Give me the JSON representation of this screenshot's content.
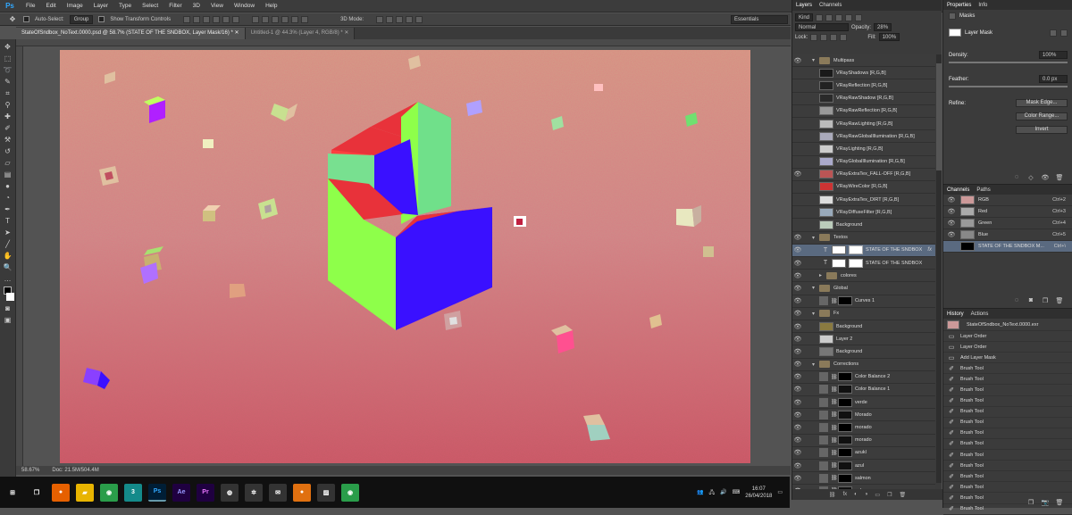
{
  "menubar": {
    "logo": "Ps",
    "items": [
      "File",
      "Edit",
      "Image",
      "Layer",
      "Type",
      "Select",
      "Filter",
      "3D",
      "View",
      "Window",
      "Help"
    ],
    "controls": [
      "–",
      "□",
      "✕"
    ]
  },
  "options": {
    "auto_select_label": "Auto-Select:",
    "auto_select_value": "Group",
    "transform_label": "Show Transform Controls",
    "mode_3d_label": "3D Mode:",
    "workspace": "Essentials"
  },
  "tabs": [
    {
      "label": "StateOfSndbox_NoText.0000.psd @ 58.7% (STATE OF THE SNDBOX, Layer Mask/16) *  ✕",
      "active": true
    },
    {
      "label": "Untitled-1 @ 44.3% (Layer 4, RGB/8) *  ✕",
      "active": false
    }
  ],
  "status": {
    "zoom": "58.67%",
    "doc": "Doc: 21.5M/504.4M"
  },
  "layers": {
    "tabs": [
      "Layers",
      "Channels"
    ],
    "kind_label": "Kind",
    "blend_mode": "Normal",
    "opacity_label": "Opacity:",
    "opacity_value": "28%",
    "lock_label": "Lock:",
    "fill_label": "Fill:",
    "fill_value": "100%",
    "items": [
      {
        "name": "Multipass",
        "type": "group",
        "eye": true,
        "depth": 0
      },
      {
        "name": "VRayShadows [R,G,B]",
        "type": "layer",
        "eye": false,
        "depth": 1,
        "thumb": "#1a1a1a"
      },
      {
        "name": "VRayReflection [R,G,B]",
        "type": "layer",
        "eye": false,
        "depth": 1,
        "thumb": "#222"
      },
      {
        "name": "VRayRawShadow [R,G,B]",
        "type": "layer",
        "eye": false,
        "depth": 1,
        "thumb": "#2a2a2a"
      },
      {
        "name": "VRayRawReflection [R,G,B]",
        "type": "layer",
        "eye": false,
        "depth": 1,
        "thumb": "#999"
      },
      {
        "name": "VRayRawLighting [R,G,B]",
        "type": "layer",
        "eye": false,
        "depth": 1,
        "thumb": "#bbb"
      },
      {
        "name": "VRayRawGlobalIllumination [R,G,B]",
        "type": "layer",
        "eye": false,
        "depth": 1,
        "thumb": "#aab"
      },
      {
        "name": "VRayLighting [R,G,B]",
        "type": "layer",
        "eye": false,
        "depth": 1,
        "thumb": "#ccc"
      },
      {
        "name": "VRayGlobalIllumination [R,G,B]",
        "type": "layer",
        "eye": false,
        "depth": 1,
        "thumb": "#aac"
      },
      {
        "name": "VRayExtraTex_FALL-OFF [R,G,B]",
        "type": "layer",
        "eye": true,
        "depth": 1,
        "thumb": "#b55"
      },
      {
        "name": "VRayWireColor [R,G,B]",
        "type": "layer",
        "eye": false,
        "depth": 1,
        "thumb": "#c33"
      },
      {
        "name": "VRayExtraTex_DIRT [R,G,B]",
        "type": "layer",
        "eye": false,
        "depth": 1,
        "thumb": "#ddd"
      },
      {
        "name": "VRayDiffuseFilter [R,G,B]",
        "type": "layer",
        "eye": false,
        "depth": 1,
        "thumb": "#9ab"
      },
      {
        "name": "Background",
        "type": "layer",
        "eye": false,
        "depth": 1,
        "thumb": "#bcb"
      },
      {
        "name": "Textos",
        "type": "group",
        "eye": true,
        "depth": 0
      },
      {
        "name": "STATE OF THE SNDBOX",
        "type": "text",
        "eye": true,
        "depth": 1,
        "selected": true,
        "fx": "fx"
      },
      {
        "name": "STATE OF THE SNDBOX",
        "type": "text",
        "eye": true,
        "depth": 1
      },
      {
        "name": "colores",
        "type": "group",
        "eye": true,
        "depth": 1,
        "collapsed": true
      },
      {
        "name": "Global",
        "type": "group",
        "eye": true,
        "depth": 0
      },
      {
        "name": "Curves 1",
        "type": "adjust",
        "eye": true,
        "depth": 1
      },
      {
        "name": "Fx",
        "type": "group",
        "eye": true,
        "depth": 0
      },
      {
        "name": "Background",
        "type": "layer",
        "eye": true,
        "depth": 1,
        "thumb": "#8a7a40"
      },
      {
        "name": "Layer 2",
        "type": "layer",
        "eye": true,
        "depth": 1,
        "thumb": "#ccc"
      },
      {
        "name": "Background",
        "type": "layer",
        "eye": true,
        "depth": 1,
        "thumb": "#777"
      },
      {
        "name": "Corrections",
        "type": "group",
        "eye": true,
        "depth": 0
      },
      {
        "name": "Color Balance 2",
        "type": "adjust",
        "eye": true,
        "depth": 1
      },
      {
        "name": "Color Balance 1",
        "type": "adjust",
        "eye": true,
        "depth": 1
      },
      {
        "name": "verde",
        "type": "adjust",
        "eye": true,
        "depth": 1
      },
      {
        "name": "Morado",
        "type": "adjust",
        "eye": true,
        "depth": 1
      },
      {
        "name": "morado",
        "type": "adjust",
        "eye": true,
        "depth": 1
      },
      {
        "name": "morado",
        "type": "adjust",
        "eye": true,
        "depth": 1
      },
      {
        "name": "azukl",
        "type": "adjust",
        "eye": true,
        "depth": 1
      },
      {
        "name": "azul",
        "type": "adjust",
        "eye": true,
        "depth": 1
      },
      {
        "name": "salmon",
        "type": "adjust",
        "eye": true,
        "depth": 1
      },
      {
        "name": "salmon",
        "type": "adjust",
        "eye": true,
        "depth": 1
      }
    ],
    "footer": [
      "⛓",
      "fx",
      "◐",
      "◑",
      "▭",
      "❐",
      "🗑"
    ]
  },
  "properties": {
    "tabs": [
      "Properties",
      "Info"
    ],
    "title": "Masks",
    "mask_label": "Layer Mask",
    "density_label": "Density:",
    "density_value": "100%",
    "feather_label": "Feather:",
    "feather_value": "0.0 px",
    "refine_label": "Refine:",
    "buttons": [
      "Mask Edge...",
      "Color Range...",
      "Invert"
    ]
  },
  "channels": {
    "tabs": [
      "Channels",
      "Paths"
    ],
    "items": [
      {
        "name": "RGB",
        "key": "Ctrl+2",
        "thumb": "#c99"
      },
      {
        "name": "Red",
        "key": "Ctrl+3",
        "thumb": "#aaa"
      },
      {
        "name": "Green",
        "key": "Ctrl+4",
        "thumb": "#999"
      },
      {
        "name": "Blue",
        "key": "Ctrl+5",
        "thumb": "#888"
      },
      {
        "name": "STATE OF THE SNDBOX M...",
        "key": "Ctrl+\\",
        "thumb": "#000",
        "selected": true
      }
    ]
  },
  "history": {
    "tabs": [
      "History",
      "Actions"
    ],
    "snapshot": "StateOfSndbox_NoText.0000.exr",
    "items": [
      "Layer Order",
      "Layer Order",
      "Add Layer Mask",
      "Brush Tool",
      "Brush Tool",
      "Brush Tool",
      "Brush Tool",
      "Brush Tool",
      "Brush Tool",
      "Brush Tool",
      "Brush Tool",
      "Brush Tool",
      "Brush Tool",
      "Brush Tool",
      "Brush Tool",
      "Brush Tool",
      "Brush Tool"
    ]
  },
  "taskbar": {
    "icons": [
      {
        "name": "start",
        "label": "⊞",
        "color": "#101010"
      },
      {
        "name": "task-view",
        "label": "❐",
        "color": "#101010"
      },
      {
        "name": "firefox",
        "label": "●",
        "color": "#e66000"
      },
      {
        "name": "explorer",
        "label": "▰",
        "color": "#e8b400"
      },
      {
        "name": "chrome",
        "label": "◉",
        "color": "#2a9d4a"
      },
      {
        "name": "3ds-max",
        "label": "3",
        "color": "#148a8a"
      },
      {
        "name": "photoshop",
        "label": "Ps",
        "color": "#001e36"
      },
      {
        "name": "after-effects",
        "label": "Ae",
        "color": "#1f0040"
      },
      {
        "name": "premiere",
        "label": "Pr",
        "color": "#1f0040"
      },
      {
        "name": "app-a",
        "label": "◍",
        "color": "#333"
      },
      {
        "name": "app-b",
        "label": "✲",
        "color": "#333"
      },
      {
        "name": "app-c",
        "label": "✉",
        "color": "#333"
      },
      {
        "name": "app-d",
        "label": "●",
        "color": "#e07010"
      },
      {
        "name": "app-e",
        "label": "▨",
        "color": "#333"
      },
      {
        "name": "app-f",
        "label": "◉",
        "color": "#2a9d4a"
      }
    ],
    "time": "16:07",
    "date": "26/04/2018"
  }
}
